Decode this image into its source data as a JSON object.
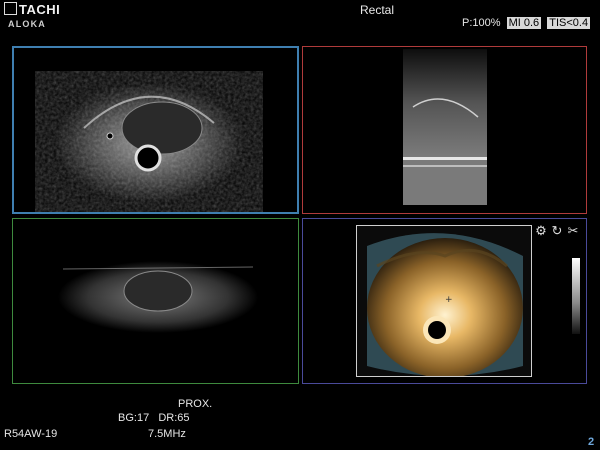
{
  "brand": {
    "top": "TACHI",
    "bottom": "ALOKA"
  },
  "header": {
    "mode_title": "Rectal",
    "power": "P:100%",
    "mi": "MI 0.6",
    "tis": "TIS<0.4"
  },
  "footer": {
    "probe_position": "PROX.",
    "gain_dr": "BG:17   DR:65",
    "probe_model": "R54AW-19",
    "frequency": "7.5MHz",
    "page_number": "2"
  },
  "tools": {
    "icons": [
      "gear-icon",
      "rotate-icon",
      "cut-icon"
    ]
  },
  "colors": {
    "panel_1_border": "#3f7fb0",
    "panel_2_border": "#b03b3b",
    "panel_3_border": "#3e8a3e",
    "panel_4_border": "#4a4a9a",
    "render_tint": "#c8924a"
  }
}
